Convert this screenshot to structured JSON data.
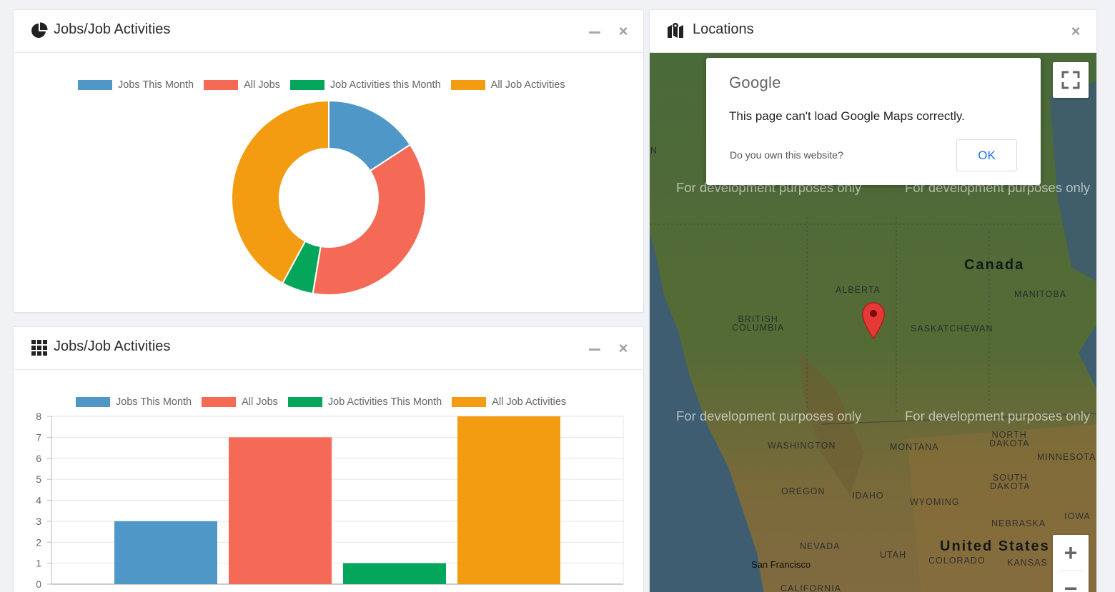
{
  "panels": {
    "donut": {
      "title": "Jobs/Job Activities",
      "icon": "pie-chart-icon",
      "legend": [
        "Jobs This Month",
        "All Jobs",
        "Job Activities this Month",
        "All Job Activities"
      ]
    },
    "bar": {
      "title": "Jobs/Job Activities",
      "icon": "grid-icon",
      "legend": [
        "Jobs This Month",
        "All Jobs",
        "Job Activities This Month",
        "All Job Activities"
      ]
    },
    "map": {
      "title": "Locations",
      "icon": "map-icon"
    }
  },
  "controls": {
    "minimize_glyph": "",
    "close_glyph": "×"
  },
  "colors": {
    "blue": "#4f97c6",
    "red": "#f46a57",
    "green": "#03a65a",
    "orange": "#f39c12"
  },
  "chart_data": [
    {
      "type": "pie",
      "legend": [
        "Jobs This Month",
        "All Jobs",
        "Job Activities this Month",
        "All Job Activities"
      ],
      "values": [
        3,
        7,
        1,
        8
      ],
      "colors": [
        "#4f97c6",
        "#f46a57",
        "#03a65a",
        "#f39c12"
      ]
    },
    {
      "type": "bar",
      "categories": [
        "Jobs This Month",
        "All Jobs",
        "Job Activities This Month",
        "All Job Activities"
      ],
      "values": [
        3,
        7,
        1,
        8
      ],
      "colors": [
        "#4f97c6",
        "#f46a57",
        "#03a65a",
        "#f39c12"
      ],
      "ylim": [
        0,
        8
      ],
      "yticks": [
        "8",
        "7",
        "6",
        "5",
        "4",
        "3",
        "2",
        "1",
        "0"
      ],
      "grid": true
    }
  ],
  "map": {
    "dialog": {
      "logo": "Google",
      "message": "This page can't load Google Maps correctly.",
      "question": "Do you own this website?",
      "ok": "OK"
    },
    "dev_watermark": "For development purposes only",
    "labels": {
      "canada": "Canada",
      "alberta": "ALBERTA",
      "manitoba": "MANITOBA",
      "british_columbia_1": "BRITISH",
      "british_columbia_2": "COLUMBIA",
      "saskatchewan": "SASKATCHEWAN",
      "washington": "WASHINGTON",
      "montana": "MONTANA",
      "north_dakota_1": "NORTH",
      "north_dakota_2": "DAKOTA",
      "minnesota": "MINNESOTA",
      "south_dakota_1": "SOUTH",
      "south_dakota_2": "DAKOTA",
      "oregon": "OREGON",
      "idaho": "IDAHO",
      "wyoming": "WYOMING",
      "nebraska": "NEBRASKA",
      "iowa": "IOWA",
      "nevada": "NEVADA",
      "utah": "UTAH",
      "united_states": "United States",
      "colorado": "COLORADO",
      "kansas": "KANSAS",
      "san_francisco": "San Francisco",
      "california": "CALIFORNIA",
      "edge_n": "N"
    },
    "zoom_in": "+",
    "zoom_out": "−"
  }
}
